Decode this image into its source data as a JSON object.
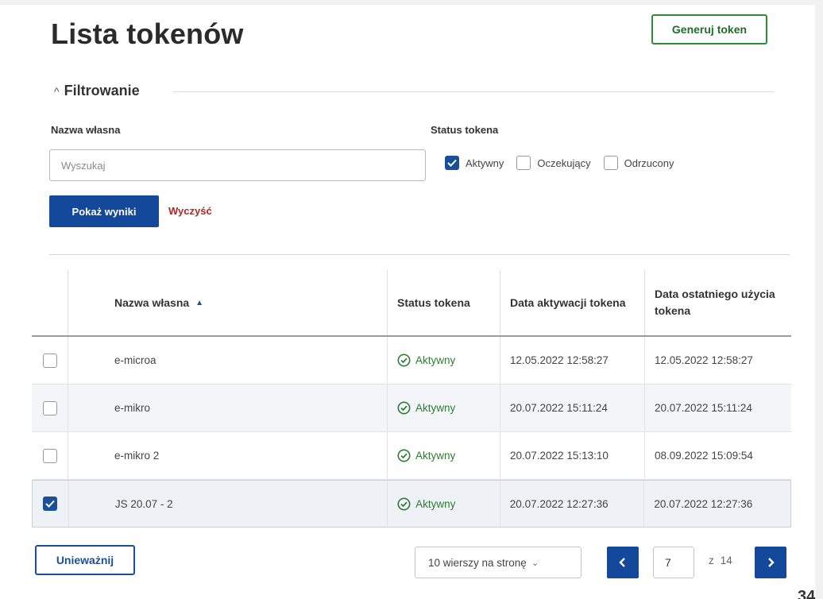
{
  "header": {
    "title": "Lista tokenów",
    "generate_label": "Generuj token"
  },
  "filter": {
    "toggle_label": "Filtrowanie",
    "name_label": "Nazwa własna",
    "search_placeholder": "Wyszukaj",
    "status_label": "Status tokena",
    "status_options": [
      {
        "label": "Aktywny",
        "checked": true
      },
      {
        "label": "Oczekujący",
        "checked": false
      },
      {
        "label": "Odrzucony",
        "checked": false
      }
    ],
    "show_label": "Pokaż wyniki",
    "clear_label": "Wyczyść"
  },
  "table": {
    "columns": [
      "Nazwa własna",
      "Status tokena",
      "Data aktywacji tokena",
      "Data ostatniego użycia tokena"
    ],
    "rows": [
      {
        "name": "e-microa",
        "status": "Aktywny",
        "activated": "12.05.2022 12:58:27",
        "last_used": "12.05.2022 12:58:27",
        "checked": false
      },
      {
        "name": "e-mikro",
        "status": "Aktywny",
        "activated": "20.07.2022 15:11:24",
        "last_used": "20.07.2022 15:11:24",
        "checked": false
      },
      {
        "name": "e-mikro 2",
        "status": "Aktywny",
        "activated": "20.07.2022 15:13:10",
        "last_used": "08.09.2022 15:09:54",
        "checked": false
      },
      {
        "name": "JS 20.07 - 2",
        "status": "Aktywny",
        "activated": "20.07.2022 12:27:36",
        "last_used": "20.07.2022 12:27:36",
        "checked": true
      }
    ]
  },
  "footer": {
    "revoke_label": "Unieważnij",
    "per_page_label": "10 wierszy na stronę",
    "current_page": "7",
    "of_label": "z",
    "total_pages": "14",
    "corner_number": "34"
  },
  "colors": {
    "primary": "#14489a",
    "success": "#2e7d32",
    "danger": "#b3261e"
  }
}
